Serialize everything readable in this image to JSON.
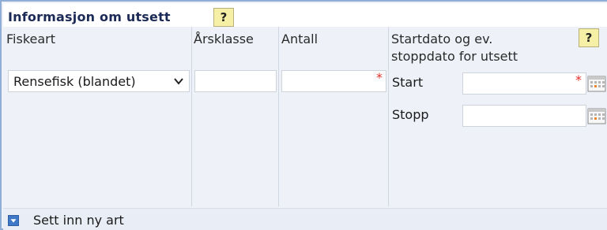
{
  "section": {
    "title": "Informasjon om utsett",
    "help_label": "?"
  },
  "columns": {
    "fiskeart": "Fiskeart",
    "arsklasse": "Årsklasse",
    "antall": "Antall",
    "dato_line1": "Startdato og ev.",
    "dato_line2": "stoppdato for utsett",
    "dato_help": "?"
  },
  "row": {
    "fiskeart_selected": "Rensefisk (blandet)",
    "arsklasse_value": "",
    "antall_value": "",
    "start_label": "Start",
    "start_value": "",
    "stopp_label": "Stopp",
    "stopp_value": "",
    "required_marker": "*"
  },
  "footer": {
    "add_label": "Sett inn ny art"
  },
  "icons": {
    "help": "help-icon",
    "dropdown": "chevron-down-icon",
    "calendar": "calendar-icon",
    "add": "expand-icon"
  },
  "colors": {
    "title": "#1b2a56",
    "help_bg": "#f5f0a6",
    "required": "#e0302b",
    "border": "#8eaed8",
    "add_icon": "#3f78c7"
  }
}
